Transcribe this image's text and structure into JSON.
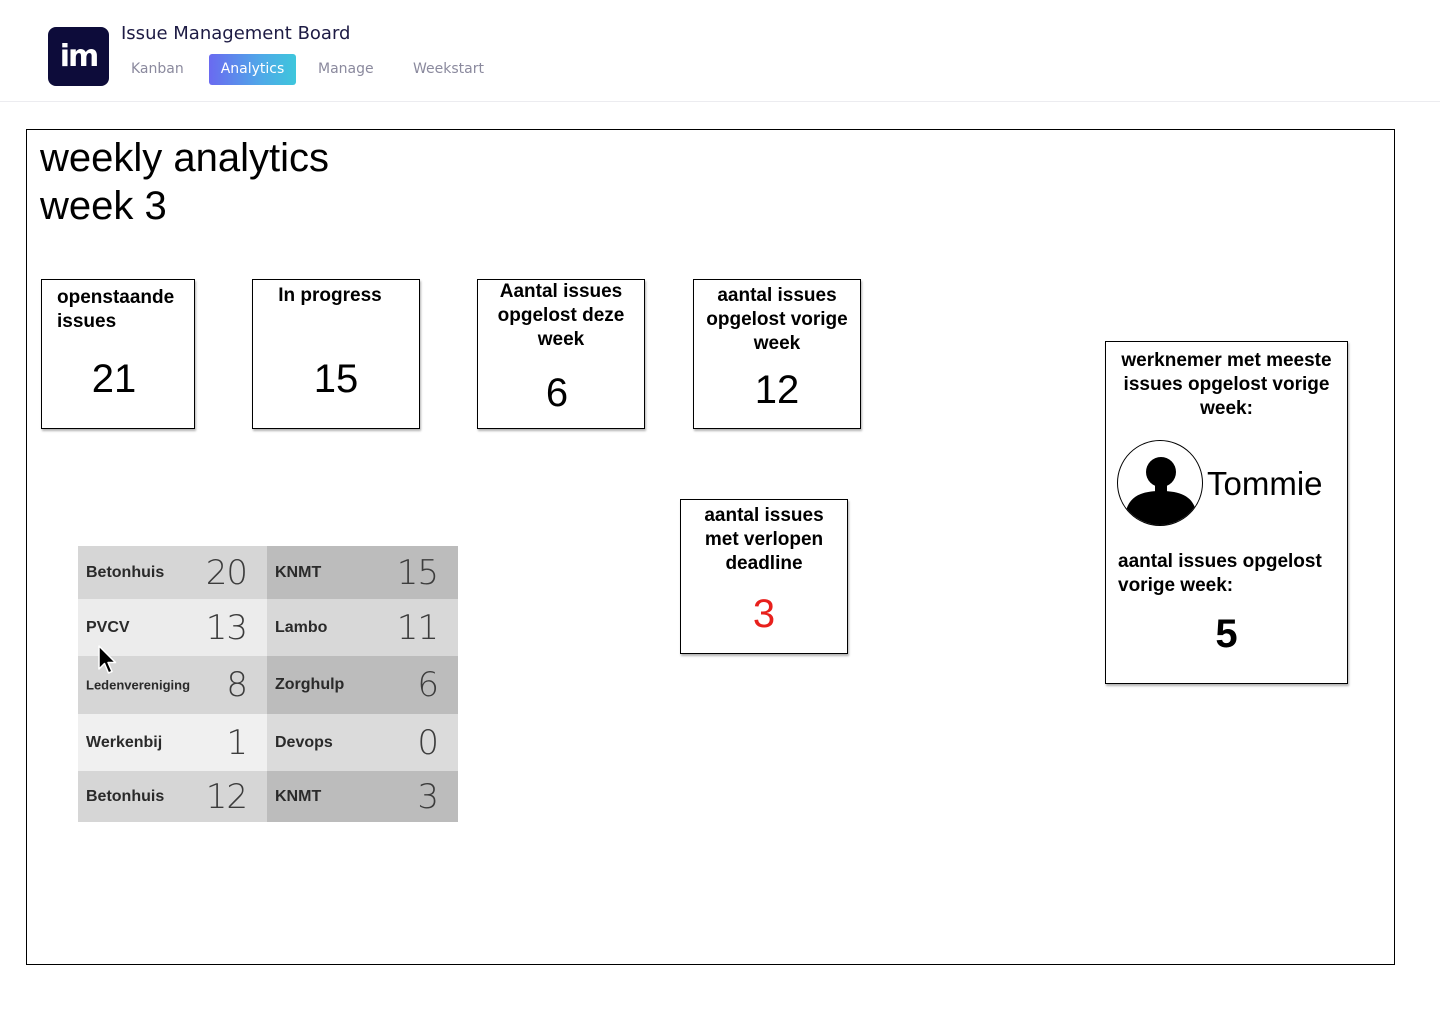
{
  "app": {
    "logo_text": "im",
    "title": "Issue Management Board"
  },
  "nav": {
    "tabs": [
      {
        "label": "Kanban",
        "active": false
      },
      {
        "label": "Analytics",
        "active": true
      },
      {
        "label": "Manage",
        "active": false
      },
      {
        "label": "Weekstart",
        "active": false
      }
    ]
  },
  "page": {
    "title_line1": "weekly analytics",
    "title_line2": "week 3"
  },
  "stats": {
    "open": {
      "label": "openstaande issues",
      "value": "21"
    },
    "in_progress": {
      "label": "In progress",
      "value": "15"
    },
    "resolved_this_week": {
      "label": "Aantal issues opgelost deze week",
      "value": "6"
    },
    "resolved_last_week": {
      "label": "aantal issues opgelost vorige week",
      "value": "12"
    },
    "overdue": {
      "label": "aantal issues met verlopen deadline",
      "value": "3",
      "value_color": "#e8201c"
    }
  },
  "top_employee": {
    "label": "werknemer met meeste issues opgelost vorige week:",
    "avatar_icon": "user-avatar-icon",
    "name": "Tommie",
    "resolved_label": "aantal issues opgelost vorige week:",
    "resolved_value": "5"
  },
  "clients": {
    "rows": [
      [
        {
          "name": "Betonhuis",
          "value": "20"
        },
        {
          "name": "KNMT",
          "value": "15"
        }
      ],
      [
        {
          "name": "PVCV",
          "value": "13"
        },
        {
          "name": "Lambo",
          "value": "11"
        }
      ],
      [
        {
          "name": "Ledenvereniging",
          "value": "8"
        },
        {
          "name": "Zorghulp",
          "value": "6"
        }
      ],
      [
        {
          "name": "Werkenbij",
          "value": "1"
        },
        {
          "name": "Devops",
          "value": "0"
        }
      ],
      [
        {
          "name": "Betonhuis",
          "value": "12"
        },
        {
          "name": "KNMT",
          "value": "3"
        }
      ]
    ]
  },
  "colors": {
    "brand_dark": "#0d0c3a",
    "tab_active_gradient_start": "#6a6af0",
    "tab_active_gradient_end": "#3ec6dc",
    "overdue_red": "#e8201c"
  }
}
